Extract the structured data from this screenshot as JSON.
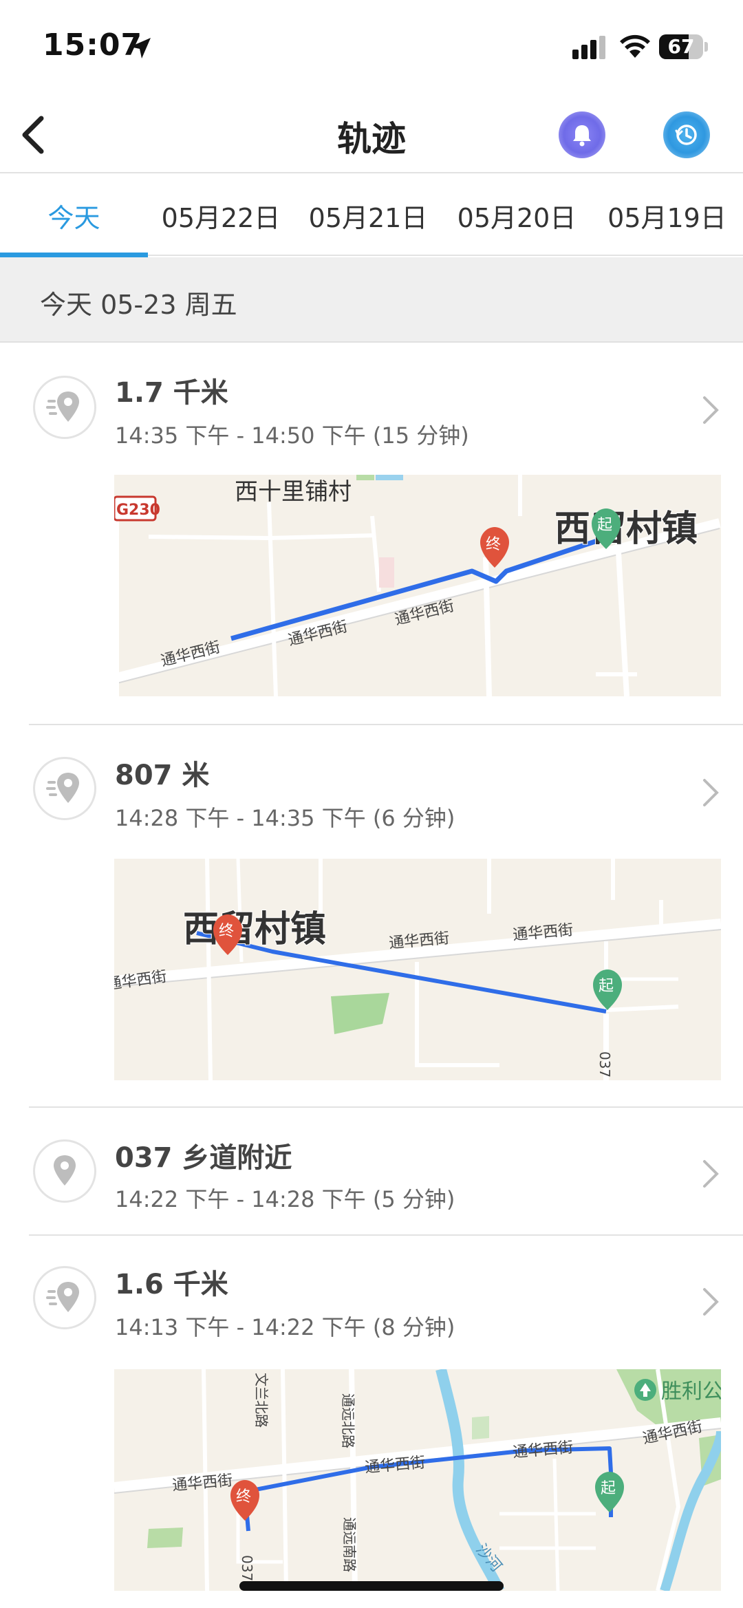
{
  "status_bar": {
    "time": "15:07",
    "battery_level": "67",
    "battery_fraction": 0.67
  },
  "nav": {
    "title": "轨迹"
  },
  "tabs": [
    {
      "label": "今天"
    },
    {
      "label": "05月22日"
    },
    {
      "label": "05月21日"
    },
    {
      "label": "05月20日"
    },
    {
      "label": "05月19日"
    }
  ],
  "day_header": "今天 05-23 周五",
  "records": [
    {
      "title": "1.7 千米",
      "time": "14:35 下午 - 14:50 下午 (15 分钟)",
      "icon": "track-pin-icon",
      "map": {
        "labels": [
          "西十里铺村",
          "西留村镇",
          "G230",
          "通华西街",
          "通华西街",
          "通华西街",
          "通华西街"
        ],
        "start_marker": "起",
        "end_marker": "终"
      }
    },
    {
      "title": "807 米",
      "time": "14:28 下午 - 14:35 下午 (6 分钟)",
      "icon": "track-pin-icon",
      "map": {
        "labels": [
          "西留村镇",
          "通华西街",
          "通华西街",
          "通华西街",
          "037"
        ],
        "start_marker": "起",
        "end_marker": "终"
      }
    },
    {
      "title": "037 乡道附近",
      "time": "14:22 下午 - 14:28 下午 (5 分钟)",
      "icon": "location-pin-icon"
    },
    {
      "title": "1.6 千米",
      "time": "14:13 下午 - 14:22 下午 (8 分钟)",
      "icon": "track-pin-icon",
      "map": {
        "labels": [
          "胜利公",
          "文兰北路",
          "通远北路",
          "通远南路",
          "通华西街",
          "通华西街",
          "通华西街",
          "通华西街",
          "沙河",
          "037"
        ],
        "start_marker": "起",
        "end_marker": "终"
      }
    }
  ],
  "colors": {
    "accent": "#2a9ae0",
    "route": "#2f6de8",
    "start_marker": "#4cae7c",
    "end_marker": "#e0533c"
  }
}
